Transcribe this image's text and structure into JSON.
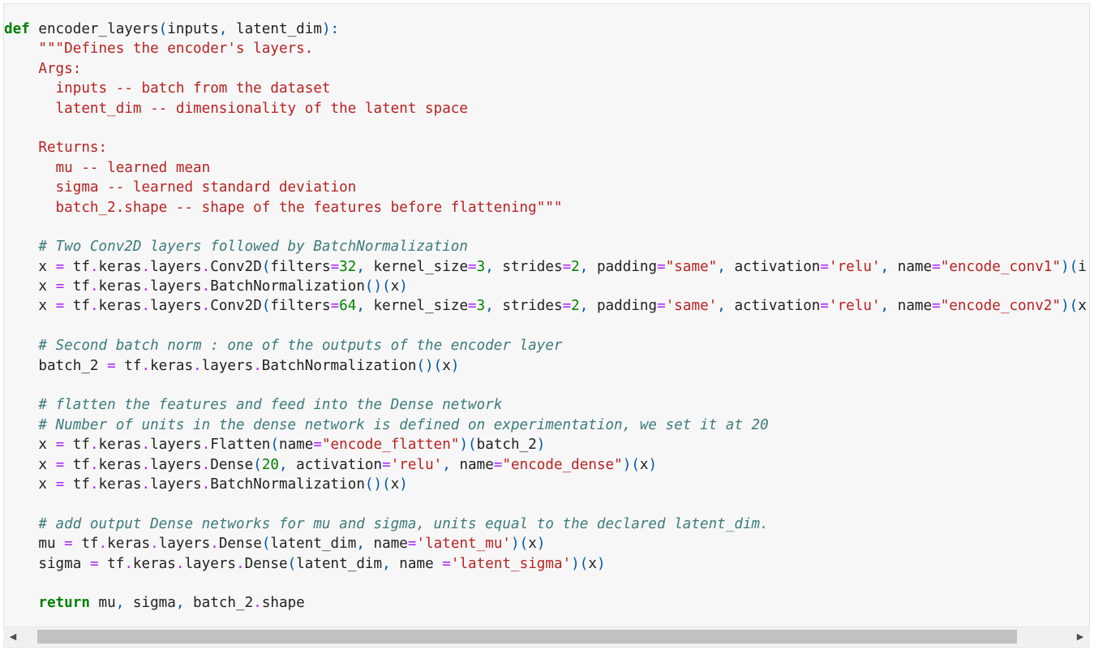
{
  "code_lines": [
    [
      {
        "t": "kw",
        "v": "def"
      },
      {
        "t": "",
        "v": " encoder_layers"
      },
      {
        "t": "pun",
        "v": "("
      },
      {
        "t": "",
        "v": "inputs"
      },
      {
        "t": "pun",
        "v": ","
      },
      {
        "t": "",
        "v": " latent_dim"
      },
      {
        "t": "pun",
        "v": "):"
      }
    ],
    [
      {
        "t": "str",
        "v": "    \"\"\"Defines the encoder's layers."
      }
    ],
    [
      {
        "t": "str",
        "v": "    Args:"
      }
    ],
    [
      {
        "t": "str",
        "v": "      inputs -- batch from the dataset"
      }
    ],
    [
      {
        "t": "str",
        "v": "      latent_dim -- dimensionality of the latent space"
      }
    ],
    [],
    [
      {
        "t": "str",
        "v": "    Returns:"
      }
    ],
    [
      {
        "t": "str",
        "v": "      mu -- learned mean"
      }
    ],
    [
      {
        "t": "str",
        "v": "      sigma -- learned standard deviation"
      }
    ],
    [
      {
        "t": "str",
        "v": "      batch_2.shape -- shape of the features before flattening\"\"\""
      }
    ],
    [],
    [
      {
        "t": "",
        "v": "    "
      },
      {
        "t": "cmt",
        "v": "# Two Conv2D layers followed by BatchNormalization"
      }
    ],
    [
      {
        "t": "",
        "v": "    x "
      },
      {
        "t": "op",
        "v": "="
      },
      {
        "t": "",
        "v": " tf"
      },
      {
        "t": "op",
        "v": "."
      },
      {
        "t": "",
        "v": "keras"
      },
      {
        "t": "op",
        "v": "."
      },
      {
        "t": "",
        "v": "layers"
      },
      {
        "t": "op",
        "v": "."
      },
      {
        "t": "",
        "v": "Conv2D"
      },
      {
        "t": "pun",
        "v": "("
      },
      {
        "t": "",
        "v": "filters"
      },
      {
        "t": "op",
        "v": "="
      },
      {
        "t": "num",
        "v": "32"
      },
      {
        "t": "pun",
        "v": ","
      },
      {
        "t": "",
        "v": " kernel_size"
      },
      {
        "t": "op",
        "v": "="
      },
      {
        "t": "num",
        "v": "3"
      },
      {
        "t": "pun",
        "v": ","
      },
      {
        "t": "",
        "v": " strides"
      },
      {
        "t": "op",
        "v": "="
      },
      {
        "t": "num",
        "v": "2"
      },
      {
        "t": "pun",
        "v": ","
      },
      {
        "t": "",
        "v": " padding"
      },
      {
        "t": "op",
        "v": "="
      },
      {
        "t": "str",
        "v": "\"same\""
      },
      {
        "t": "pun",
        "v": ","
      },
      {
        "t": "",
        "v": " activation"
      },
      {
        "t": "op",
        "v": "="
      },
      {
        "t": "str",
        "v": "'relu'"
      },
      {
        "t": "pun",
        "v": ","
      },
      {
        "t": "",
        "v": " name"
      },
      {
        "t": "op",
        "v": "="
      },
      {
        "t": "str",
        "v": "\"encode_conv1\""
      },
      {
        "t": "pun",
        "v": ")("
      },
      {
        "t": "",
        "v": "i"
      }
    ],
    [
      {
        "t": "",
        "v": "    x "
      },
      {
        "t": "op",
        "v": "="
      },
      {
        "t": "",
        "v": " tf"
      },
      {
        "t": "op",
        "v": "."
      },
      {
        "t": "",
        "v": "keras"
      },
      {
        "t": "op",
        "v": "."
      },
      {
        "t": "",
        "v": "layers"
      },
      {
        "t": "op",
        "v": "."
      },
      {
        "t": "",
        "v": "BatchNormalization"
      },
      {
        "t": "pun",
        "v": "()("
      },
      {
        "t": "",
        "v": "x"
      },
      {
        "t": "pun",
        "v": ")"
      }
    ],
    [
      {
        "t": "",
        "v": "    x "
      },
      {
        "t": "op",
        "v": "="
      },
      {
        "t": "",
        "v": " tf"
      },
      {
        "t": "op",
        "v": "."
      },
      {
        "t": "",
        "v": "keras"
      },
      {
        "t": "op",
        "v": "."
      },
      {
        "t": "",
        "v": "layers"
      },
      {
        "t": "op",
        "v": "."
      },
      {
        "t": "",
        "v": "Conv2D"
      },
      {
        "t": "pun",
        "v": "("
      },
      {
        "t": "",
        "v": "filters"
      },
      {
        "t": "op",
        "v": "="
      },
      {
        "t": "num",
        "v": "64"
      },
      {
        "t": "pun",
        "v": ","
      },
      {
        "t": "",
        "v": " kernel_size"
      },
      {
        "t": "op",
        "v": "="
      },
      {
        "t": "num",
        "v": "3"
      },
      {
        "t": "pun",
        "v": ","
      },
      {
        "t": "",
        "v": " strides"
      },
      {
        "t": "op",
        "v": "="
      },
      {
        "t": "num",
        "v": "2"
      },
      {
        "t": "pun",
        "v": ","
      },
      {
        "t": "",
        "v": " padding"
      },
      {
        "t": "op",
        "v": "="
      },
      {
        "t": "str",
        "v": "'same'"
      },
      {
        "t": "pun",
        "v": ","
      },
      {
        "t": "",
        "v": " activation"
      },
      {
        "t": "op",
        "v": "="
      },
      {
        "t": "str",
        "v": "'relu'"
      },
      {
        "t": "pun",
        "v": ","
      },
      {
        "t": "",
        "v": " name"
      },
      {
        "t": "op",
        "v": "="
      },
      {
        "t": "str",
        "v": "\"encode_conv2\""
      },
      {
        "t": "pun",
        "v": ")("
      },
      {
        "t": "",
        "v": "x"
      }
    ],
    [],
    [
      {
        "t": "",
        "v": "    "
      },
      {
        "t": "cmt",
        "v": "# Second batch norm : one of the outputs of the encoder layer"
      }
    ],
    [
      {
        "t": "",
        "v": "    batch_2 "
      },
      {
        "t": "op",
        "v": "="
      },
      {
        "t": "",
        "v": " tf"
      },
      {
        "t": "op",
        "v": "."
      },
      {
        "t": "",
        "v": "keras"
      },
      {
        "t": "op",
        "v": "."
      },
      {
        "t": "",
        "v": "layers"
      },
      {
        "t": "op",
        "v": "."
      },
      {
        "t": "",
        "v": "BatchNormalization"
      },
      {
        "t": "pun",
        "v": "()("
      },
      {
        "t": "",
        "v": "x"
      },
      {
        "t": "pun",
        "v": ")"
      }
    ],
    [],
    [
      {
        "t": "",
        "v": "    "
      },
      {
        "t": "cmt",
        "v": "# flatten the features and feed into the Dense network"
      }
    ],
    [
      {
        "t": "",
        "v": "    "
      },
      {
        "t": "cmt",
        "v": "# Number of units in the dense network is defined on experimentation, we set it at 20"
      }
    ],
    [
      {
        "t": "",
        "v": "    x "
      },
      {
        "t": "op",
        "v": "="
      },
      {
        "t": "",
        "v": " tf"
      },
      {
        "t": "op",
        "v": "."
      },
      {
        "t": "",
        "v": "keras"
      },
      {
        "t": "op",
        "v": "."
      },
      {
        "t": "",
        "v": "layers"
      },
      {
        "t": "op",
        "v": "."
      },
      {
        "t": "",
        "v": "Flatten"
      },
      {
        "t": "pun",
        "v": "("
      },
      {
        "t": "",
        "v": "name"
      },
      {
        "t": "op",
        "v": "="
      },
      {
        "t": "str",
        "v": "\"encode_flatten\""
      },
      {
        "t": "pun",
        "v": ")("
      },
      {
        "t": "",
        "v": "batch_2"
      },
      {
        "t": "pun",
        "v": ")"
      }
    ],
    [
      {
        "t": "",
        "v": "    x "
      },
      {
        "t": "op",
        "v": "="
      },
      {
        "t": "",
        "v": " tf"
      },
      {
        "t": "op",
        "v": "."
      },
      {
        "t": "",
        "v": "keras"
      },
      {
        "t": "op",
        "v": "."
      },
      {
        "t": "",
        "v": "layers"
      },
      {
        "t": "op",
        "v": "."
      },
      {
        "t": "",
        "v": "Dense"
      },
      {
        "t": "pun",
        "v": "("
      },
      {
        "t": "num",
        "v": "20"
      },
      {
        "t": "pun",
        "v": ","
      },
      {
        "t": "",
        "v": " activation"
      },
      {
        "t": "op",
        "v": "="
      },
      {
        "t": "str",
        "v": "'relu'"
      },
      {
        "t": "pun",
        "v": ","
      },
      {
        "t": "",
        "v": " name"
      },
      {
        "t": "op",
        "v": "="
      },
      {
        "t": "str",
        "v": "\"encode_dense\""
      },
      {
        "t": "pun",
        "v": ")("
      },
      {
        "t": "",
        "v": "x"
      },
      {
        "t": "pun",
        "v": ")"
      }
    ],
    [
      {
        "t": "",
        "v": "    x "
      },
      {
        "t": "op",
        "v": "="
      },
      {
        "t": "",
        "v": " tf"
      },
      {
        "t": "op",
        "v": "."
      },
      {
        "t": "",
        "v": "keras"
      },
      {
        "t": "op",
        "v": "."
      },
      {
        "t": "",
        "v": "layers"
      },
      {
        "t": "op",
        "v": "."
      },
      {
        "t": "",
        "v": "BatchNormalization"
      },
      {
        "t": "pun",
        "v": "()("
      },
      {
        "t": "",
        "v": "x"
      },
      {
        "t": "pun",
        "v": ")"
      }
    ],
    [],
    [
      {
        "t": "",
        "v": "    "
      },
      {
        "t": "cmt",
        "v": "# add output Dense networks for mu and sigma, units equal to the declared latent_dim."
      }
    ],
    [
      {
        "t": "",
        "v": "    mu "
      },
      {
        "t": "op",
        "v": "="
      },
      {
        "t": "",
        "v": " tf"
      },
      {
        "t": "op",
        "v": "."
      },
      {
        "t": "",
        "v": "keras"
      },
      {
        "t": "op",
        "v": "."
      },
      {
        "t": "",
        "v": "layers"
      },
      {
        "t": "op",
        "v": "."
      },
      {
        "t": "",
        "v": "Dense"
      },
      {
        "t": "pun",
        "v": "("
      },
      {
        "t": "",
        "v": "latent_dim"
      },
      {
        "t": "pun",
        "v": ","
      },
      {
        "t": "",
        "v": " name"
      },
      {
        "t": "op",
        "v": "="
      },
      {
        "t": "str",
        "v": "'latent_mu'"
      },
      {
        "t": "pun",
        "v": ")("
      },
      {
        "t": "",
        "v": "x"
      },
      {
        "t": "pun",
        "v": ")"
      }
    ],
    [
      {
        "t": "",
        "v": "    sigma "
      },
      {
        "t": "op",
        "v": "="
      },
      {
        "t": "",
        "v": " tf"
      },
      {
        "t": "op",
        "v": "."
      },
      {
        "t": "",
        "v": "keras"
      },
      {
        "t": "op",
        "v": "."
      },
      {
        "t": "",
        "v": "layers"
      },
      {
        "t": "op",
        "v": "."
      },
      {
        "t": "",
        "v": "Dense"
      },
      {
        "t": "pun",
        "v": "("
      },
      {
        "t": "",
        "v": "latent_dim"
      },
      {
        "t": "pun",
        "v": ","
      },
      {
        "t": "",
        "v": " name "
      },
      {
        "t": "op",
        "v": "="
      },
      {
        "t": "str",
        "v": "'latent_sigma'"
      },
      {
        "t": "pun",
        "v": ")("
      },
      {
        "t": "",
        "v": "x"
      },
      {
        "t": "pun",
        "v": ")"
      }
    ],
    [],
    [
      {
        "t": "",
        "v": "    "
      },
      {
        "t": "kw",
        "v": "return"
      },
      {
        "t": "",
        "v": " mu"
      },
      {
        "t": "pun",
        "v": ","
      },
      {
        "t": "",
        "v": " sigma"
      },
      {
        "t": "pun",
        "v": ","
      },
      {
        "t": "",
        "v": " batch_2"
      },
      {
        "t": "op",
        "v": "."
      },
      {
        "t": "",
        "v": "shape"
      }
    ]
  ],
  "scrollbar": {
    "left_arrow": "◀",
    "right_arrow": "▶"
  }
}
